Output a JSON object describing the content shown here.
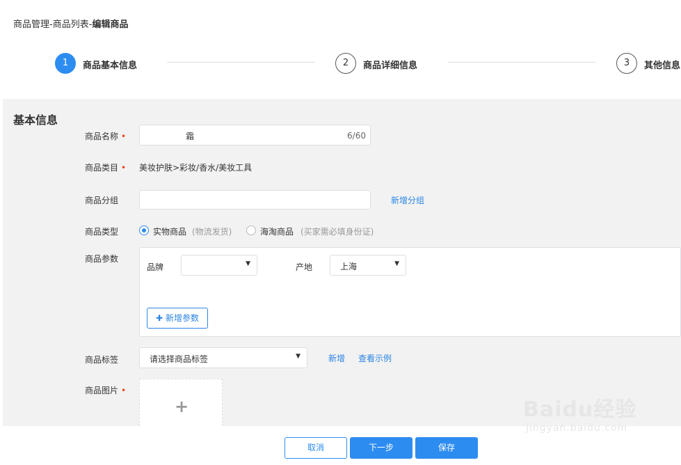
{
  "breadcrumb": {
    "part1": "商品管理",
    "sep1": "-",
    "part2": "商品列表",
    "sep2": "-",
    "current": "编辑商品"
  },
  "steps": [
    {
      "num": "1",
      "title": "商品基本信息",
      "active": true
    },
    {
      "num": "2",
      "title": "商品详细信息",
      "active": false
    },
    {
      "num": "3",
      "title": "其他信息",
      "active": false
    }
  ],
  "section": {
    "title": "基本信息"
  },
  "form": {
    "name": {
      "label": "商品名称",
      "required": "•",
      "value": "霜",
      "count": "6/60"
    },
    "category": {
      "label": "商品类目",
      "required": "•",
      "value": "美妆护肤>彩妆/香水/美妆工具"
    },
    "group": {
      "label": "商品分组",
      "value": "",
      "add_link": "新增分组"
    },
    "type": {
      "label": "商品类型",
      "options": [
        {
          "label": "实物商品",
          "hint": "(物流发货)",
          "checked": true
        },
        {
          "label": "海淘商品",
          "hint": "(买家需必填身份证)",
          "checked": false
        }
      ]
    },
    "params": {
      "label": "商品参数",
      "brand_label": "品牌",
      "brand_value": "",
      "origin_label": "产地",
      "origin_value": "上海",
      "add_button": "新增参数"
    },
    "tags": {
      "label": "商品标签",
      "placeholder": "请选择商品标签",
      "add_link": "新增",
      "example_link": "查看示例"
    },
    "images": {
      "label": "商品图片",
      "required": "•"
    }
  },
  "footer": {
    "cancel": "取消",
    "next": "下一步",
    "save": "保存"
  },
  "watermark": {
    "main": "Baidu经验",
    "sub": "jingyan.baidu.com"
  },
  "colors": {
    "primary": "#2d8cf0",
    "required": "#ed4014",
    "panel_bg": "#f2f2f2"
  }
}
